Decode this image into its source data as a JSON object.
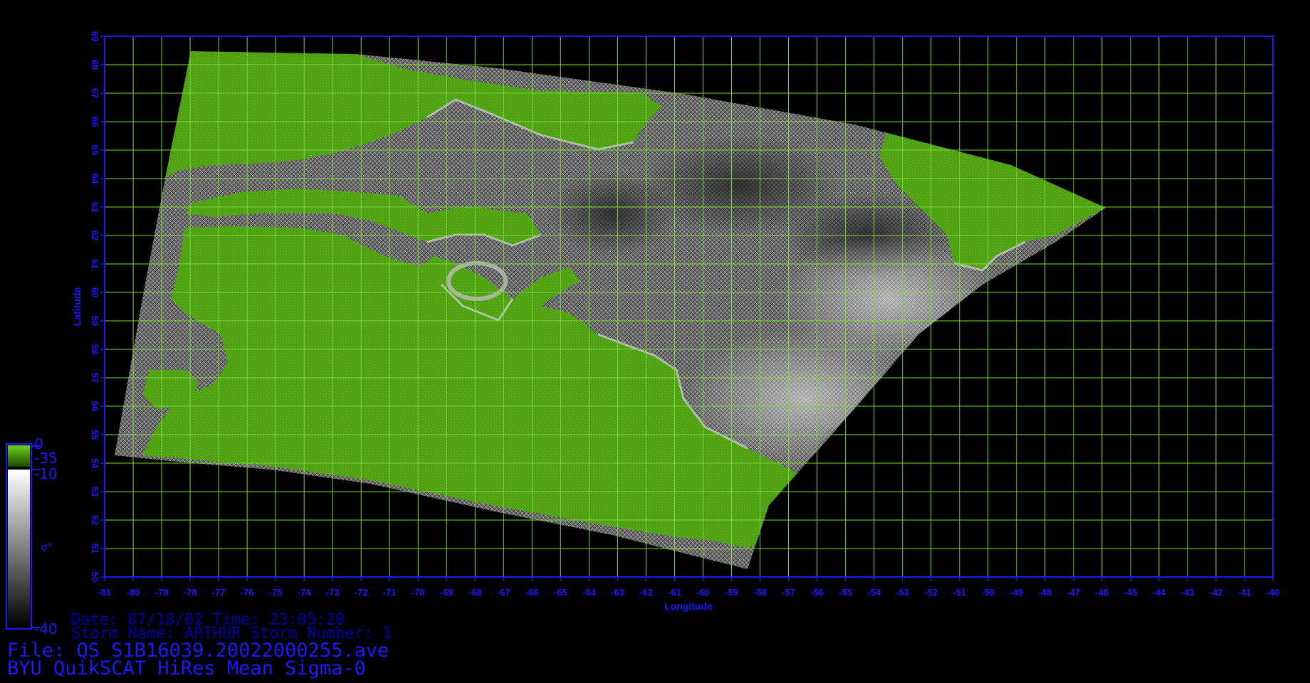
{
  "map": {
    "xlabel": "Longitude",
    "ylabel": "Latitude",
    "lon_range": [
      -81,
      -40
    ],
    "lat_range": [
      50,
      69
    ],
    "lon_ticks": [
      "-81",
      "-80",
      "-79",
      "-78",
      "-77",
      "-76",
      "-75",
      "-74",
      "-73",
      "-72",
      "-71",
      "-70",
      "-69",
      "-68",
      "-67",
      "-66",
      "-65",
      "-64",
      "-63",
      "-62",
      "-61",
      "-60",
      "-59",
      "-58",
      "-57",
      "-56",
      "-55",
      "-54",
      "-53",
      "-52",
      "-51",
      "-50",
      "-49",
      "-48",
      "-47",
      "-46",
      "-45",
      "-44",
      "-43",
      "-42",
      "-41",
      "-40"
    ],
    "lat_ticks": [
      "50",
      "51",
      "52",
      "53",
      "54",
      "55",
      "56",
      "57",
      "58",
      "59",
      "60",
      "61",
      "62",
      "63",
      "64",
      "65",
      "66",
      "67",
      "68",
      "69"
    ],
    "grid": true,
    "colors": {
      "grid": "#7cd83a",
      "axes": "#1a1aff",
      "land": "#4a9a10",
      "ocean_dark": "#2a2a2a",
      "ocean_light": "#c8c8c8"
    }
  },
  "colorbar": {
    "land_max": "0",
    "land_min": "-35",
    "ocean_max": "-10",
    "ocean_min": "-40",
    "units": "σ°"
  },
  "meta": {
    "date_line": "Date: 07/18/02  Time: 23:05:20",
    "storm_line": "Storm  Name: ARTHUR   Storm  Number: 1"
  },
  "file": {
    "file_line": "File: QS_S1B16039.20022000255.ave",
    "product_line": "BYU  QuikSCAT  HiRes  Mean  Sigma-0"
  }
}
